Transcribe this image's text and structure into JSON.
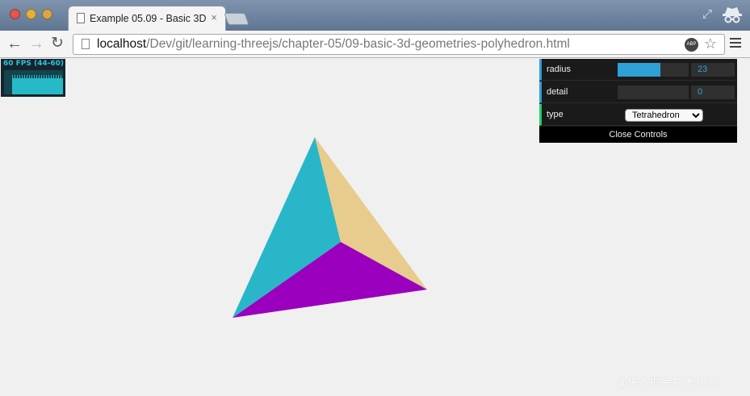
{
  "browser": {
    "tab": {
      "title": "Example 05.09 - Basic 3D",
      "close": "×"
    },
    "address_bar": {
      "host": "localhost",
      "path": "/Dev/git/learning-threejs/chapter-05/09-basic-3d-geometries-polyhedron.html"
    },
    "ext_label": "ABP",
    "icons": [
      "back-icon",
      "forward-icon",
      "reload-icon",
      "page-icon",
      "star-icon",
      "menu-icon",
      "incognito-icon",
      "fullscreen-icon"
    ]
  },
  "stats": {
    "fps_text": "60 FPS (44-60)"
  },
  "controls": {
    "radius": {
      "label": "radius",
      "value": "23",
      "level": 0.6
    },
    "detail": {
      "label": "detail",
      "value": "0",
      "level": 0.0
    },
    "type": {
      "label": "type",
      "selected": "Tetrahedron"
    },
    "close_label": "Close Controls"
  },
  "scene": {
    "shape": "tetrahedron",
    "face_colors": [
      "#29b6c8",
      "#e8cc8d",
      "#9a00bd"
    ]
  },
  "watermark": "@稀土掘金技术社区"
}
